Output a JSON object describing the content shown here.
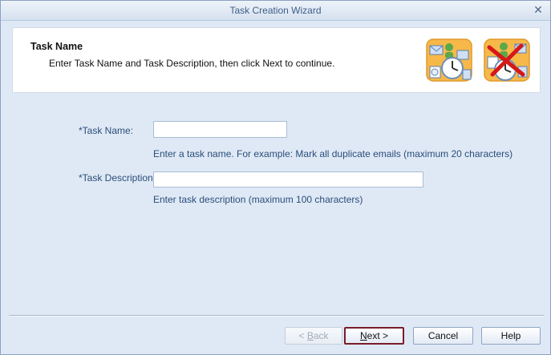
{
  "window": {
    "title": "Task Creation Wizard",
    "close_glyph": "✕"
  },
  "header": {
    "title": "Task Name",
    "subtitle": "Enter Task Name and Task Description, then click Next to continue.",
    "icons": [
      "mail-clock-icon",
      "mail-clock-cancel-icon"
    ]
  },
  "form": {
    "task_name": {
      "label": "*Task Name:",
      "value": "",
      "hint": "Enter a task name. For example: Mark all duplicate emails (maximum 20 characters)"
    },
    "task_description": {
      "label": "*Task Description:",
      "value": "",
      "hint": "Enter task description (maximum 100 characters)"
    }
  },
  "buttons": {
    "back": {
      "prefix": "< ",
      "mnemonic": "B",
      "rest": "ack",
      "enabled": false
    },
    "next": {
      "mnemonic": "N",
      "rest": "ext >",
      "enabled": true
    },
    "cancel": "Cancel",
    "help": "Help"
  },
  "colors": {
    "accent": "#7a1d2a",
    "label": "#2a4d7a",
    "window_bg": "#dfe9f5"
  }
}
